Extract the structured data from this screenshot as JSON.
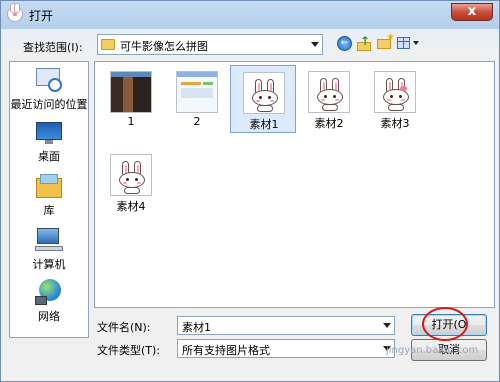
{
  "window": {
    "title": "打开",
    "close_label": "x"
  },
  "toolbar": {
    "look_in_label": "查找范围(I):",
    "look_in_value": "可牛影像怎么拼图",
    "back_label": "←",
    "up_label": "↑",
    "new_folder_label": "★"
  },
  "places": [
    {
      "label": "最近访问的位置",
      "icon": "recent-places-icon"
    },
    {
      "label": "桌面",
      "icon": "desktop-icon"
    },
    {
      "label": "库",
      "icon": "libraries-icon"
    },
    {
      "label": "计算机",
      "icon": "computer-icon"
    },
    {
      "label": "网络",
      "icon": "network-icon"
    }
  ],
  "files": [
    {
      "label": "1",
      "kind": "photo",
      "selected": false
    },
    {
      "label": "2",
      "kind": "webpage",
      "selected": false
    },
    {
      "label": "素材1",
      "kind": "bunny",
      "selected": true
    },
    {
      "label": "素材2",
      "kind": "bunny",
      "selected": false
    },
    {
      "label": "素材3",
      "kind": "bunny",
      "selected": false
    },
    {
      "label": "素材4",
      "kind": "bunny",
      "selected": false
    }
  ],
  "form": {
    "filename_label": "文件名(N):",
    "filename_value": "素材1",
    "filetype_label": "文件类型(T):",
    "filetype_value": "所有支持图片格式"
  },
  "buttons": {
    "open_label": "打开(O",
    "cancel_label": "取消"
  },
  "watermark": "jingyan.baidu.com",
  "colors": {
    "selection": "#dcebfc",
    "highlight_ring": "#d51a1a",
    "close_button": "#c8503c"
  }
}
